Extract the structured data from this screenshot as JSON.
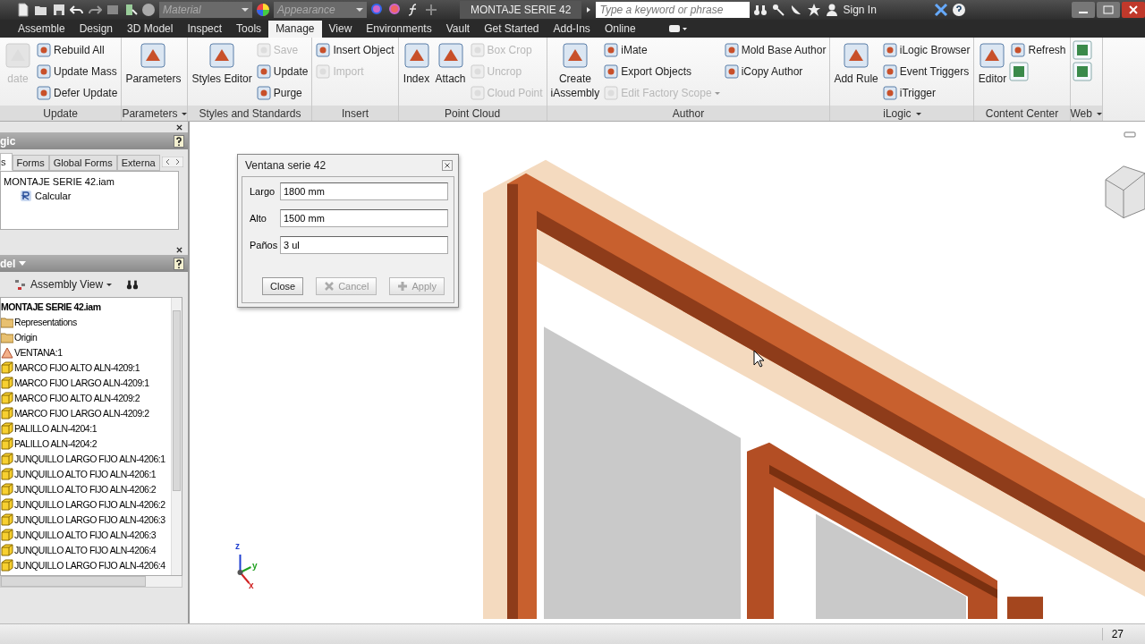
{
  "quick_access": {
    "material": "Material",
    "appearance": "Appearance",
    "document_title": "MONTAJE SERIE 42",
    "search": {
      "placeholder": "Type a keyword or phrase"
    },
    "sign_in": "Sign In"
  },
  "tabs": [
    {
      "label": "Assemble",
      "selected": false
    },
    {
      "label": "Design",
      "selected": false
    },
    {
      "label": "3D Model",
      "selected": false
    },
    {
      "label": "Inspect",
      "selected": false
    },
    {
      "label": "Tools",
      "selected": false
    },
    {
      "label": "Manage",
      "selected": true
    },
    {
      "label": "View",
      "selected": false
    },
    {
      "label": "Environments",
      "selected": false
    },
    {
      "label": "Vault",
      "selected": false
    },
    {
      "label": "Get Started",
      "selected": false
    },
    {
      "label": "Add-Ins",
      "selected": false
    },
    {
      "label": "Online",
      "selected": false
    }
  ],
  "ribbon": [
    {
      "title": "Update",
      "dropdown": false,
      "items": [
        {
          "kind": "large",
          "label": "date",
          "disabled": true
        },
        {
          "kind": "small",
          "label": "Rebuild All",
          "disabled": false
        },
        {
          "kind": "small",
          "label": "Update Mass",
          "disabled": false
        },
        {
          "kind": "small",
          "label": "Defer Update",
          "disabled": false
        }
      ]
    },
    {
      "title": "Parameters",
      "dropdown": true,
      "items": [
        {
          "kind": "large",
          "label": "Parameters",
          "disabled": false
        }
      ]
    },
    {
      "title": "Styles and Standards",
      "dropdown": false,
      "items": [
        {
          "kind": "large",
          "label": "Styles Editor",
          "disabled": false
        },
        {
          "kind": "small",
          "label": "Save",
          "disabled": true
        },
        {
          "kind": "small",
          "label": "Update",
          "disabled": false
        },
        {
          "kind": "small",
          "label": "Purge",
          "disabled": false
        }
      ]
    },
    {
      "title": "Insert",
      "dropdown": false,
      "items": [
        {
          "kind": "small",
          "label": "Insert Object",
          "disabled": false
        },
        {
          "kind": "small",
          "label": "Import",
          "disabled": true
        }
      ]
    },
    {
      "title": "Point Cloud",
      "dropdown": false,
      "items": [
        {
          "kind": "large",
          "label": "Index",
          "disabled": false
        },
        {
          "kind": "large",
          "label": "Attach",
          "disabled": false
        },
        {
          "kind": "small",
          "label": "Box Crop",
          "disabled": true
        },
        {
          "kind": "small",
          "label": "Uncrop",
          "disabled": true
        },
        {
          "kind": "small",
          "label": "Cloud Point",
          "disabled": true
        }
      ]
    },
    {
      "title": "Author",
      "dropdown": false,
      "items": [
        {
          "kind": "large",
          "label": "Create\niAssembly",
          "disabled": false
        },
        {
          "kind": "small",
          "label": "iMate",
          "disabled": false
        },
        {
          "kind": "small",
          "label": "Export Objects",
          "disabled": false
        },
        {
          "kind": "small",
          "label": "Edit Factory Scope",
          "disabled": true,
          "dropdown": true
        },
        {
          "kind": "small",
          "label": "Mold Base Author",
          "disabled": false
        },
        {
          "kind": "small",
          "label": "iCopy Author",
          "disabled": false
        }
      ]
    },
    {
      "title": "iLogic",
      "dropdown": true,
      "items": [
        {
          "kind": "large",
          "label": "Add Rule",
          "disabled": false
        },
        {
          "kind": "small",
          "label": "iLogic Browser",
          "disabled": false
        },
        {
          "kind": "small",
          "label": "Event Triggers",
          "disabled": false
        },
        {
          "kind": "small",
          "label": "iTrigger",
          "disabled": false
        }
      ]
    },
    {
      "title": "Content Center",
      "dropdown": false,
      "items": [
        {
          "kind": "large",
          "label": "Editor",
          "disabled": false
        },
        {
          "kind": "small",
          "label": "Refresh",
          "disabled": false
        },
        {
          "kind": "icon",
          "disabled": false
        }
      ]
    },
    {
      "title": "Web",
      "dropdown": true,
      "items": [
        {
          "kind": "icon",
          "disabled": false
        },
        {
          "kind": "icon",
          "disabled": false
        }
      ]
    }
  ],
  "ilogic_panel": {
    "title": "gic",
    "tabs": [
      {
        "label": "s",
        "selected": true
      },
      {
        "label": "Forms",
        "selected": false
      },
      {
        "label": "Global Forms",
        "selected": false
      },
      {
        "label": "Externa",
        "selected": false
      }
    ],
    "tree": [
      {
        "label": "MONTAJE SERIE 42.iam",
        "children": [
          {
            "label": "Calcular",
            "kind": "rule"
          }
        ]
      }
    ]
  },
  "model_panel": {
    "title": "del",
    "view": "Assembly View",
    "tree": [
      {
        "label": "MONTAJE SERIE 42.iam",
        "kind": "root",
        "children": [
          {
            "label": "Representations",
            "kind": "folder"
          },
          {
            "label": "Origin",
            "kind": "folder"
          },
          {
            "label": "VENTANA:1",
            "kind": "assembly"
          },
          {
            "label": "MARCO FIJO ALTO ALN-4209:1",
            "kind": "part"
          },
          {
            "label": "MARCO FIJO LARGO ALN-4209:1",
            "kind": "part"
          },
          {
            "label": "MARCO FIJO ALTO ALN-4209:2",
            "kind": "part"
          },
          {
            "label": "MARCO FIJO LARGO ALN-4209:2",
            "kind": "part"
          },
          {
            "label": "PALILLO ALN-4204:1",
            "kind": "part"
          },
          {
            "label": "PALILLO ALN-4204:2",
            "kind": "part"
          },
          {
            "label": "JUNQUILLO LARGO FIJO ALN-4206:1",
            "kind": "part"
          },
          {
            "label": "JUNQUILLO ALTO FIJO ALN-4206:1",
            "kind": "part"
          },
          {
            "label": "JUNQUILLO ALTO FIJO ALN-4206:2",
            "kind": "part"
          },
          {
            "label": "JUNQUILLO LARGO FIJO ALN-4206:2",
            "kind": "part"
          },
          {
            "label": "JUNQUILLO LARGO FIJO ALN-4206:3",
            "kind": "part"
          },
          {
            "label": "JUNQUILLO ALTO FIJO ALN-4206:3",
            "kind": "part"
          },
          {
            "label": "JUNQUILLO ALTO FIJO ALN-4206:4",
            "kind": "part"
          },
          {
            "label": "JUNQUILLO LARGO FIJO ALN-4206:4",
            "kind": "part"
          }
        ]
      }
    ]
  },
  "dialog": {
    "title": "Ventana serie 42",
    "fields": [
      {
        "label": "Largo",
        "value": "1800 mm"
      },
      {
        "label": "Alto",
        "value": "1500 mm"
      },
      {
        "label": "Paños",
        "value": "3 ul"
      }
    ],
    "buttons": [
      {
        "kind": "plain",
        "label": "Close",
        "disabled": false
      },
      {
        "kind": "cancel",
        "label": "Cancel",
        "disabled": true
      },
      {
        "kind": "apply",
        "label": "Apply",
        "disabled": true
      }
    ]
  },
  "axes": [
    {
      "label": "z",
      "color": "#1f3fd0"
    },
    {
      "label": "y",
      "color": "#1fa01f"
    },
    {
      "label": "x",
      "color": "#d02020"
    }
  ],
  "status_bar": {
    "number": "27"
  }
}
